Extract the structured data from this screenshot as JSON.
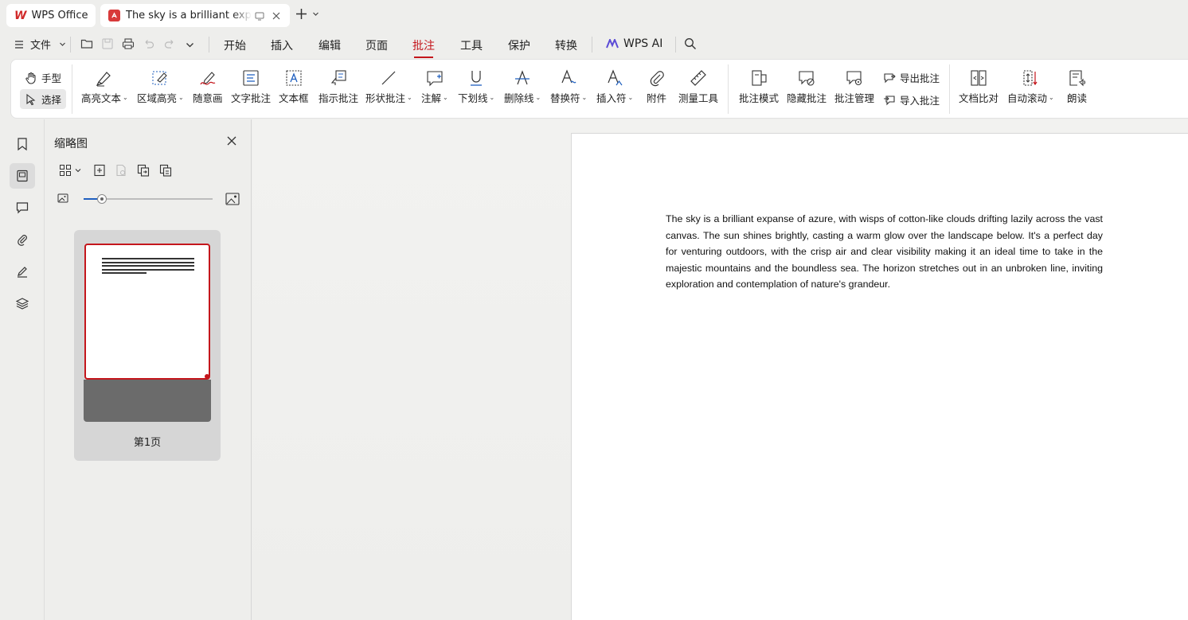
{
  "tabs": {
    "home_label": "WPS Office",
    "doc_title": "The sky is a brilliant expanse"
  },
  "menu": {
    "file": "文件",
    "items": [
      "开始",
      "插入",
      "编辑",
      "页面",
      "批注",
      "工具",
      "保护",
      "转换"
    ],
    "active": "批注",
    "ai_label": "WPS AI"
  },
  "ribbon": {
    "hand": "手型",
    "select": "选择",
    "highlight_text": "高亮文本",
    "area_highlight": "区域高亮",
    "freehand": "随意画",
    "text_comment": "文字批注",
    "textbox": "文本框",
    "callout_comment": "指示批注",
    "shape_comment": "形状批注",
    "note": "注解",
    "underline": "下划线",
    "strikethrough": "删除线",
    "replace": "替换符",
    "insert_mark": "插入符",
    "attachment": "附件",
    "measure": "测量工具",
    "comment_mode": "批注模式",
    "hide_comments": "隐藏批注",
    "manage_comments": "批注管理",
    "export_comments": "导出批注",
    "import_comments": "导入批注",
    "doc_compare": "文档比对",
    "auto_scroll": "自动滚动",
    "read_aloud": "朗读"
  },
  "panel": {
    "title": "缩略图",
    "zoom_level": 0.14,
    "page_label": "第1页"
  },
  "document": {
    "paragraph": "The sky is a brilliant expanse of azure, with wisps of cotton-like clouds drifting lazily across the vast canvas. The sun shines brightly, casting a warm glow over the landscape below. It's a perfect day for venturing outdoors, with the crisp air and clear visibility making it an ideal time to take in the majestic mountains and the boundless sea. The horizon stretches out in an unbroken line, inviting exploration and contemplation of nature's grandeur."
  },
  "colors": {
    "accent": "#c4161c",
    "slider": "#1f5fbf"
  }
}
